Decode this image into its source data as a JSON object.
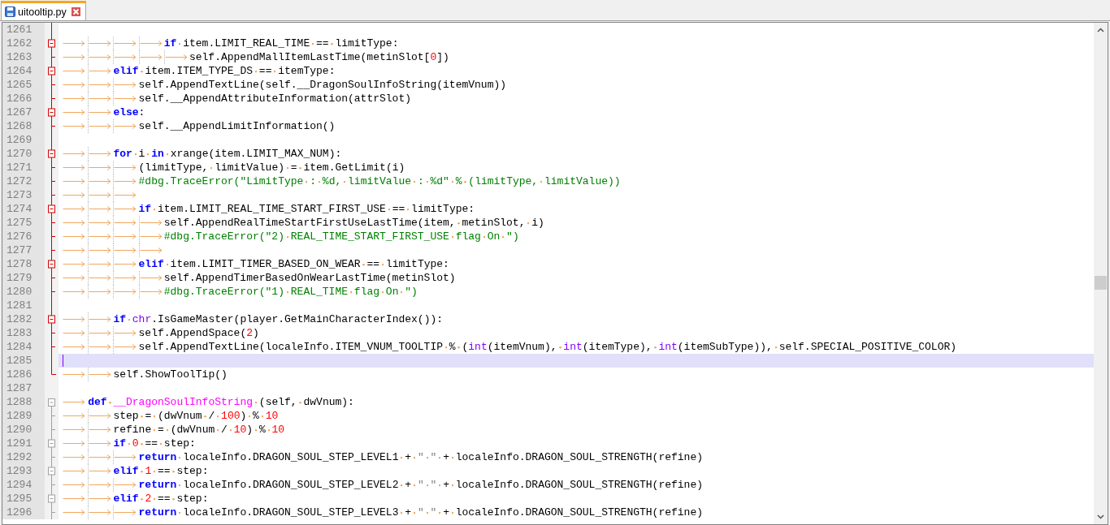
{
  "tabs": [
    {
      "label": "uitooltip.py",
      "selected": true
    }
  ],
  "lines": [
    {
      "number": "1261",
      "kind": "line",
      "fold_active": true,
      "current": false
    },
    {
      "number": "1262",
      "kind": "box",
      "fold_active": true,
      "current": false,
      "indent": [
        {
          "kind": "tab"
        },
        {
          "kind": "tab"
        },
        {
          "kind": "tab"
        },
        {
          "kind": "tab"
        }
      ],
      "tokens": [
        {
          "kind": "kw",
          "text": "if"
        },
        {
          "kind": "plain",
          "text": " item.LIMIT_REAL_TIME == limitType:"
        }
      ]
    },
    {
      "number": "1263",
      "kind": "tee",
      "fold_active": true,
      "current": false,
      "indent": [
        {
          "kind": "tab"
        },
        {
          "kind": "tab"
        },
        {
          "kind": "tab"
        },
        {
          "kind": "tab"
        },
        {
          "kind": "tab"
        }
      ],
      "tokens": [
        {
          "kind": "plain",
          "text": "self.AppendMallItemLastTime(metinSlot["
        },
        {
          "kind": "num",
          "text": "0"
        },
        {
          "kind": "plain",
          "text": "])"
        }
      ]
    },
    {
      "number": "1264",
      "kind": "box",
      "fold_active": true,
      "current": false,
      "indent": [
        {
          "kind": "tab"
        },
        {
          "kind": "tab"
        }
      ],
      "tokens": [
        {
          "kind": "kw",
          "text": "elif"
        },
        {
          "kind": "plain",
          "text": " item.ITEM_TYPE_DS == itemType:"
        }
      ]
    },
    {
      "number": "1265",
      "kind": "tee",
      "fold_active": true,
      "current": false,
      "indent": [
        {
          "kind": "tab"
        },
        {
          "kind": "tab"
        },
        {
          "kind": "tab"
        }
      ],
      "tokens": [
        {
          "kind": "plain",
          "text": "self.AppendTextLine(self.__DragonSoulInfoString(itemVnum))"
        }
      ]
    },
    {
      "number": "1266",
      "kind": "tee",
      "fold_active": true,
      "current": false,
      "indent": [
        {
          "kind": "tab"
        },
        {
          "kind": "tab"
        },
        {
          "kind": "tab"
        }
      ],
      "tokens": [
        {
          "kind": "plain",
          "text": "self.__AppendAttributeInformation(attrSlot)"
        }
      ]
    },
    {
      "number": "1267",
      "kind": "box",
      "fold_active": true,
      "current": false,
      "indent": [
        {
          "kind": "tab"
        },
        {
          "kind": "tab"
        }
      ],
      "tokens": [
        {
          "kind": "kw",
          "text": "else"
        },
        {
          "kind": "plain",
          "text": ":"
        }
      ]
    },
    {
      "number": "1268",
      "kind": "tee",
      "fold_active": true,
      "current": false,
      "indent": [
        {
          "kind": "tab"
        },
        {
          "kind": "tab"
        },
        {
          "kind": "tab"
        }
      ],
      "tokens": [
        {
          "kind": "plain",
          "text": "self.__AppendLimitInformation()"
        }
      ]
    },
    {
      "number": "1269",
      "kind": "line",
      "fold_active": true,
      "current": false
    },
    {
      "number": "1270",
      "kind": "box",
      "fold_active": true,
      "current": false,
      "indent": [
        {
          "kind": "tab"
        },
        {
          "kind": "tab"
        }
      ],
      "tokens": [
        {
          "kind": "kw",
          "text": "for"
        },
        {
          "kind": "plain",
          "text": " i "
        },
        {
          "kind": "kw",
          "text": "in"
        },
        {
          "kind": "plain",
          "text": " xrange(item.LIMIT_MAX_NUM):"
        }
      ]
    },
    {
      "number": "1271",
      "kind": "tee",
      "fold_active": true,
      "current": false,
      "indent": [
        {
          "kind": "tab"
        },
        {
          "kind": "tab"
        },
        {
          "kind": "tab"
        }
      ],
      "tokens": [
        {
          "kind": "plain",
          "text": "(limitType, limitValue) = item.GetLimit(i)"
        }
      ]
    },
    {
      "number": "1272",
      "kind": "tee",
      "fold_active": true,
      "current": false,
      "indent": [
        {
          "kind": "tab"
        },
        {
          "kind": "tab"
        },
        {
          "kind": "tab"
        }
      ],
      "tokens": [
        {
          "kind": "comment",
          "text": "#dbg.TraceError(\"LimitType : %d, limitValue : %d\" % (limitType, limitValue))"
        }
      ]
    },
    {
      "number": "1273",
      "kind": "tee",
      "fold_active": true,
      "current": false,
      "indent": [
        {
          "kind": "tab"
        },
        {
          "kind": "tab"
        },
        {
          "kind": "tab"
        }
      ]
    },
    {
      "number": "1274",
      "kind": "box",
      "fold_active": true,
      "current": false,
      "indent": [
        {
          "kind": "tab"
        },
        {
          "kind": "tab"
        },
        {
          "kind": "tab"
        }
      ],
      "tokens": [
        {
          "kind": "kw",
          "text": "if"
        },
        {
          "kind": "plain",
          "text": " item.LIMIT_REAL_TIME_START_FIRST_USE == limitType:"
        }
      ]
    },
    {
      "number": "1275",
      "kind": "tee",
      "fold_active": true,
      "current": false,
      "indent": [
        {
          "kind": "tab"
        },
        {
          "kind": "tab"
        },
        {
          "kind": "tab"
        },
        {
          "kind": "tab"
        }
      ],
      "tokens": [
        {
          "kind": "plain",
          "text": "self.AppendRealTimeStartFirstUseLastTime(item, metinSlot, i)"
        }
      ]
    },
    {
      "number": "1276",
      "kind": "tee",
      "fold_active": true,
      "current": false,
      "indent": [
        {
          "kind": "tab"
        },
        {
          "kind": "tab"
        },
        {
          "kind": "tab"
        },
        {
          "kind": "tab"
        }
      ],
      "tokens": [
        {
          "kind": "comment",
          "text": "#dbg.TraceError(\"2) REAL_TIME_START_FIRST_USE flag On \")"
        }
      ]
    },
    {
      "number": "1277",
      "kind": "tee",
      "fold_active": true,
      "current": false,
      "indent": [
        {
          "kind": "tab"
        },
        {
          "kind": "tab"
        },
        {
          "kind": "tab"
        },
        {
          "kind": "tab"
        }
      ]
    },
    {
      "number": "1278",
      "kind": "box",
      "fold_active": true,
      "current": false,
      "indent": [
        {
          "kind": "tab"
        },
        {
          "kind": "tab"
        },
        {
          "kind": "tab"
        }
      ],
      "tokens": [
        {
          "kind": "kw",
          "text": "elif"
        },
        {
          "kind": "plain",
          "text": " item.LIMIT_TIMER_BASED_ON_WEAR == limitType:"
        }
      ]
    },
    {
      "number": "1279",
      "kind": "tee",
      "fold_active": true,
      "current": false,
      "indent": [
        {
          "kind": "tab"
        },
        {
          "kind": "tab"
        },
        {
          "kind": "tab"
        },
        {
          "kind": "tab"
        }
      ],
      "tokens": [
        {
          "kind": "plain",
          "text": "self.AppendTimerBasedOnWearLastTime(metinSlot)"
        }
      ]
    },
    {
      "number": "1280",
      "kind": "tee",
      "fold_active": true,
      "current": false,
      "indent": [
        {
          "kind": "tab"
        },
        {
          "kind": "tab"
        },
        {
          "kind": "tab"
        },
        {
          "kind": "tab"
        }
      ],
      "tokens": [
        {
          "kind": "comment",
          "text": "#dbg.TraceError(\"1) REAL_TIME flag On \")"
        }
      ]
    },
    {
      "number": "1281",
      "kind": "line",
      "fold_active": true,
      "current": false
    },
    {
      "number": "1282",
      "kind": "box",
      "fold_active": true,
      "current": false,
      "indent": [
        {
          "kind": "tab"
        },
        {
          "kind": "tab"
        }
      ],
      "tokens": [
        {
          "kind": "kw",
          "text": "if"
        },
        {
          "kind": "builtin",
          "text": " chr"
        },
        {
          "kind": "plain",
          "text": ".IsGameMaster(player.GetMainCharacterIndex()):"
        }
      ]
    },
    {
      "number": "1283",
      "kind": "tee",
      "fold_active": true,
      "current": false,
      "indent": [
        {
          "kind": "tab"
        },
        {
          "kind": "tab"
        },
        {
          "kind": "tab"
        }
      ],
      "tokens": [
        {
          "kind": "plain",
          "text": "self.AppendSpace("
        },
        {
          "kind": "num",
          "text": "2"
        },
        {
          "kind": "plain",
          "text": ")"
        }
      ]
    },
    {
      "number": "1284",
      "kind": "tee",
      "fold_active": true,
      "current": false,
      "indent": [
        {
          "kind": "tab"
        },
        {
          "kind": "tab"
        },
        {
          "kind": "tab"
        }
      ],
      "tokens": [
        {
          "kind": "plain",
          "text": "self.AppendTextLine(localeInfo.ITEM_VNUM_TOOLTIP % ("
        },
        {
          "kind": "builtin",
          "text": "int"
        },
        {
          "kind": "plain",
          "text": "(itemVnum), "
        },
        {
          "kind": "builtin",
          "text": "int"
        },
        {
          "kind": "plain",
          "text": "(itemType), "
        },
        {
          "kind": "builtin",
          "text": "int"
        },
        {
          "kind": "plain",
          "text": "(itemSubType)), self.SPECIAL_POSITIVE_COLOR)"
        }
      ]
    },
    {
      "number": "1285",
      "kind": "line",
      "fold_active": true,
      "current": true
    },
    {
      "number": "1286",
      "kind": "end",
      "fold_active": true,
      "current": false,
      "indent": [
        {
          "kind": "tab"
        },
        {
          "kind": "tab"
        }
      ],
      "tokens": [
        {
          "kind": "plain",
          "text": "self.ShowToolTip()"
        }
      ]
    },
    {
      "number": "1287",
      "kind": "none",
      "current": false
    },
    {
      "number": "1288",
      "kind": "box_top",
      "fold_active": false,
      "current": false,
      "indent": [
        {
          "kind": "tab"
        }
      ],
      "tokens": [
        {
          "kind": "kw",
          "text": "def"
        },
        {
          "kind": "fn",
          "text": " __DragonSoulInfoString"
        },
        {
          "kind": "plain",
          "text": " (self, dwVnum):"
        }
      ]
    },
    {
      "number": "1289",
      "kind": "tee",
      "fold_active": false,
      "current": false,
      "indent": [
        {
          "kind": "tab"
        },
        {
          "kind": "tab"
        }
      ],
      "tokens": [
        {
          "kind": "plain",
          "text": "step = (dwVnum / "
        },
        {
          "kind": "num",
          "text": "100"
        },
        {
          "kind": "plain",
          "text": ") % "
        },
        {
          "kind": "num",
          "text": "10"
        }
      ]
    },
    {
      "number": "1290",
      "kind": "tee",
      "fold_active": false,
      "current": false,
      "indent": [
        {
          "kind": "tab"
        },
        {
          "kind": "tab"
        }
      ],
      "tokens": [
        {
          "kind": "plain",
          "text": "refine = (dwVnum / "
        },
        {
          "kind": "num",
          "text": "10"
        },
        {
          "kind": "plain",
          "text": ") % "
        },
        {
          "kind": "num",
          "text": "10"
        }
      ]
    },
    {
      "number": "1291",
      "kind": "box",
      "fold_active": false,
      "current": false,
      "indent": [
        {
          "kind": "tab"
        },
        {
          "kind": "tab"
        }
      ],
      "tokens": [
        {
          "kind": "kw",
          "text": "if"
        },
        {
          "kind": "num",
          "text": " 0"
        },
        {
          "kind": "plain",
          "text": " == step:"
        }
      ]
    },
    {
      "number": "1292",
      "kind": "tee",
      "fold_active": false,
      "current": false,
      "indent": [
        {
          "kind": "tab"
        },
        {
          "kind": "tab"
        },
        {
          "kind": "tab"
        }
      ],
      "tokens": [
        {
          "kind": "kw",
          "text": "return"
        },
        {
          "kind": "plain",
          "text": " localeInfo.DRAGON_SOUL_STEP_LEVEL1 + "
        },
        {
          "kind": "str",
          "text": "\" \""
        },
        {
          "kind": "plain",
          "text": " + localeInfo.DRAGON_SOUL_STRENGTH(refine)"
        }
      ]
    },
    {
      "number": "1293",
      "kind": "box",
      "fold_active": false,
      "current": false,
      "indent": [
        {
          "kind": "tab"
        },
        {
          "kind": "tab"
        }
      ],
      "tokens": [
        {
          "kind": "kw",
          "text": "elif"
        },
        {
          "kind": "num",
          "text": " 1"
        },
        {
          "kind": "plain",
          "text": " == step:"
        }
      ]
    },
    {
      "number": "1294",
      "kind": "tee",
      "fold_active": false,
      "current": false,
      "indent": [
        {
          "kind": "tab"
        },
        {
          "kind": "tab"
        },
        {
          "kind": "tab"
        }
      ],
      "tokens": [
        {
          "kind": "kw",
          "text": "return"
        },
        {
          "kind": "plain",
          "text": " localeInfo.DRAGON_SOUL_STEP_LEVEL2 + "
        },
        {
          "kind": "str",
          "text": "\" \""
        },
        {
          "kind": "plain",
          "text": " + localeInfo.DRAGON_SOUL_STRENGTH(refine)"
        }
      ]
    },
    {
      "number": "1295",
      "kind": "box",
      "fold_active": false,
      "current": false,
      "indent": [
        {
          "kind": "tab"
        },
        {
          "kind": "tab"
        }
      ],
      "tokens": [
        {
          "kind": "kw",
          "text": "elif"
        },
        {
          "kind": "num",
          "text": " 2"
        },
        {
          "kind": "plain",
          "text": " == step:"
        }
      ]
    },
    {
      "number": "1296",
      "kind": "tee",
      "fold_active": false,
      "current": false,
      "indent": [
        {
          "kind": "tab"
        },
        {
          "kind": "tab"
        },
        {
          "kind": "tab"
        }
      ],
      "tokens": [
        {
          "kind": "kw",
          "text": "return"
        },
        {
          "kind": "plain",
          "text": " localeInfo.DRAGON_SOUL_STEP_LEVEL3 + "
        },
        {
          "kind": "str",
          "text": "\" \""
        },
        {
          "kind": "plain",
          "text": " + localeInfo.DRAGON_SOUL_STRENGTH(refine)"
        }
      ]
    }
  ]
}
